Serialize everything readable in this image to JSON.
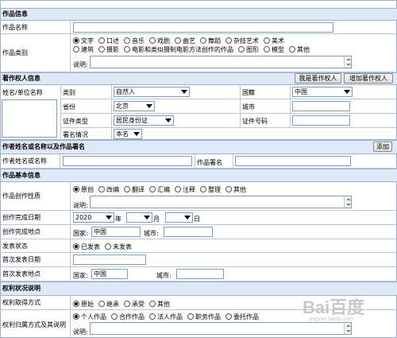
{
  "sections": {
    "work_info": "作品信息",
    "rights_holder": "著作权人信息",
    "author": "作者姓名或名称以及作品署名",
    "basic": "作品基本信息",
    "rights": "权利状况说明"
  },
  "work": {
    "name_label": "作品名称",
    "name_value": "",
    "type_label": "作品类别",
    "type_options_row1": [
      "文字",
      "口述",
      "音乐",
      "戏剧",
      "曲艺",
      "舞蹈",
      "杂技艺术",
      "美术"
    ],
    "type_options_row2": [
      "建筑",
      "摄影",
      "电影和类似摄制电影方法创作的作品",
      "图形",
      "模型",
      "其他"
    ],
    "type_selected": "文字",
    "note_label": "说明:"
  },
  "holder": {
    "btn_me": "我是著作权人",
    "btn_add": "增加著作权人",
    "name_label": "姓名/单位名称",
    "category_label": "类别",
    "category_value": "自然人",
    "nationality_label": "国籍",
    "nationality_value": "中国",
    "province_label": "省份",
    "province_value": "北京",
    "city_label": "城市",
    "id_type_label": "证件类型",
    "id_type_value": "居民身份证",
    "id_no_label": "证件号码",
    "signature_label": "署名情况",
    "signature_value": "本名"
  },
  "author": {
    "btn_add": "添加",
    "name_label": "作者姓名或名称",
    "sign_label": "作品署名"
  },
  "basic": {
    "nature_label": "作品创作性质",
    "nature_options": [
      "原创",
      "改编",
      "翻译",
      "汇编",
      "注释",
      "整理",
      "其他"
    ],
    "nature_selected": "原创",
    "note_label": "说明:",
    "finish_date_label": "创作完成日期",
    "year_value": "2020",
    "year_unit": "年",
    "month_value": "",
    "month_unit": "月",
    "day_value": "",
    "day_unit": "日",
    "finish_place_label": "创作完成地点",
    "country_label": "国家:",
    "country_value": "中国",
    "city_label": "城市:",
    "publish_status_label": "发表状态",
    "publish_options": [
      "已发表",
      "未发表"
    ],
    "publish_selected": "已发表",
    "first_date_label": "首次发表日期",
    "first_place_label": "首次发表地点",
    "first_country_label": "国家:",
    "first_country_value": "中国",
    "first_city_label": "城市:"
  },
  "rights": {
    "acquire_label": "权利取得方式",
    "acquire_options": [
      "原始",
      "继承",
      "承受",
      "其他"
    ],
    "acquire_selected": "原始",
    "belong_label": "权利归属方式及其说明",
    "belong_options": [
      "个人作品",
      "合作作品",
      "法人作品",
      "职务作品",
      "委托作品"
    ],
    "belong_selected": "个人作品",
    "note_label": "说明:"
  },
  "watermark": {
    "main": "Bai百度",
    "sub": "jingyan.baidu.com"
  }
}
